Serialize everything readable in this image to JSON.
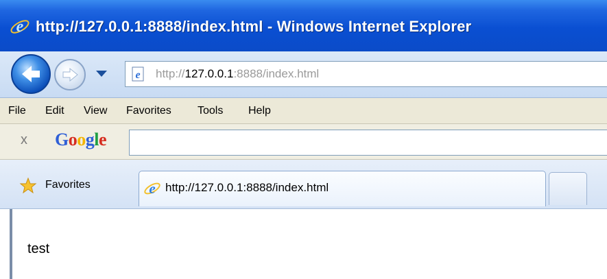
{
  "window": {
    "title": "http://127.0.0.1:8888/index.html - Windows Internet Explorer"
  },
  "address_bar": {
    "url_prefix": "http://",
    "url_host": "127.0.0.1",
    "url_rest": ":8888/index.html"
  },
  "menu": {
    "items": [
      "File",
      "Edit",
      "View",
      "Favorites",
      "Tools",
      "Help"
    ]
  },
  "google_toolbar": {
    "close_glyph": "x",
    "logo_letters": [
      "G",
      "o",
      "o",
      "g",
      "l",
      "e"
    ],
    "search_value": ""
  },
  "favorites_bar": {
    "favorites_label": "Favorites",
    "active_tab_label": "http://127.0.0.1:8888/index.html"
  },
  "page": {
    "body_text": "test"
  },
  "icons": {
    "ie_logo": "internet-explorer-icon",
    "back": "back-arrow-icon",
    "forward": "forward-arrow-icon",
    "dropdown": "chevron-down-icon",
    "favorites": "star-icon"
  },
  "colors": {
    "titlebar_blue": "#0a4fd2",
    "menubar_bg": "#ece9d8",
    "tab_bar_bg": "#d4e2f5"
  }
}
